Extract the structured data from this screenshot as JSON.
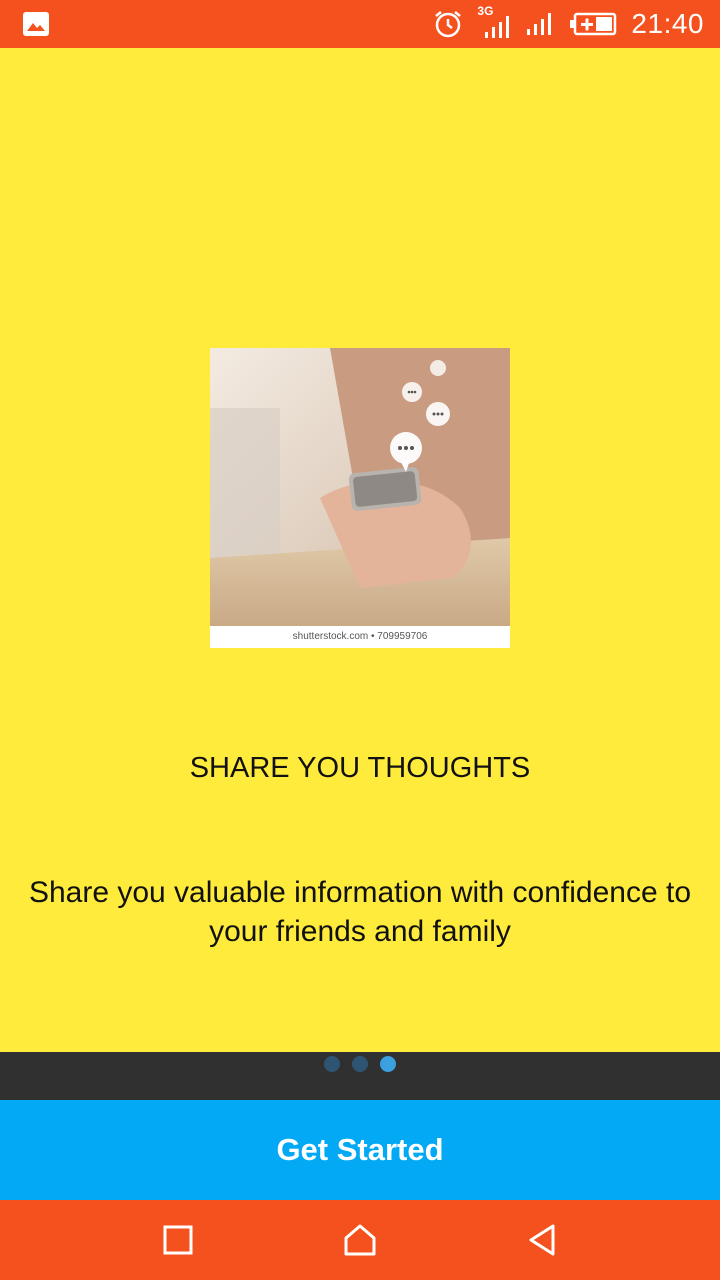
{
  "status_bar": {
    "time": "21:40",
    "network_label": "3G",
    "icons": [
      "image-notification-icon",
      "alarm-icon",
      "signal-3g-icon",
      "signal-icon",
      "battery-icon"
    ]
  },
  "slide": {
    "title": "SHARE YOU THOUGHTS",
    "description": "Share you valuable information with confidence to your friends and family",
    "image_caption": "shutterstock.com • 709959706",
    "page_count": 3,
    "active_page": 3
  },
  "cta": {
    "label": "Get Started"
  },
  "nav": {
    "icons": [
      "recent-apps-icon",
      "home-icon",
      "back-icon"
    ]
  },
  "colors": {
    "status_bar": "#f4511e",
    "background": "#ffeb3b",
    "indicator_bar": "#303030",
    "button": "#03a9f4",
    "dot_active": "#3aa0e0",
    "dot_inactive": "#2f5473"
  }
}
